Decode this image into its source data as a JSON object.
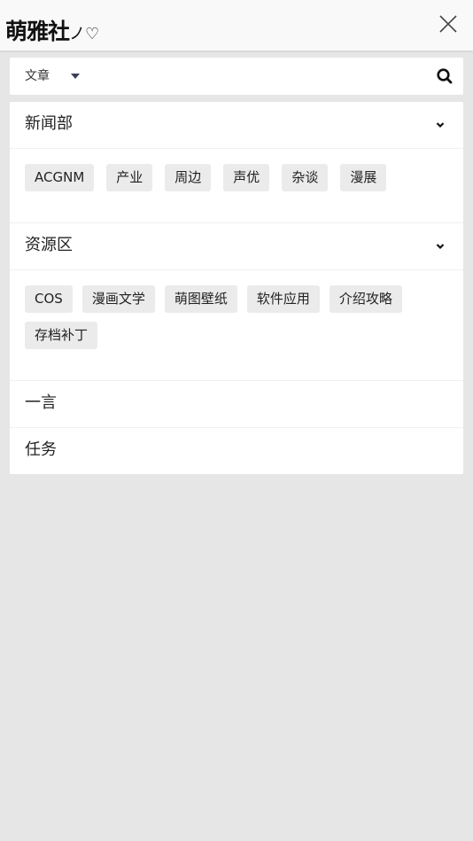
{
  "header": {
    "logo_text": "萌雅社",
    "logo_suffix": "ノ♡",
    "close_icon": "close-icon"
  },
  "search": {
    "type_label": "文章",
    "value": "",
    "placeholder": "",
    "search_icon": "search-icon"
  },
  "sections": [
    {
      "title": "新闻部",
      "tags": [
        "ACGNM",
        "产业",
        "周边",
        "声优",
        "杂谈",
        "漫展"
      ]
    },
    {
      "title": "资源区",
      "tags": [
        "COS",
        "漫画文学",
        "萌图壁纸",
        "软件应用",
        "介绍攻略",
        "存档补丁"
      ]
    }
  ],
  "links": [
    "一言",
    "任务"
  ]
}
